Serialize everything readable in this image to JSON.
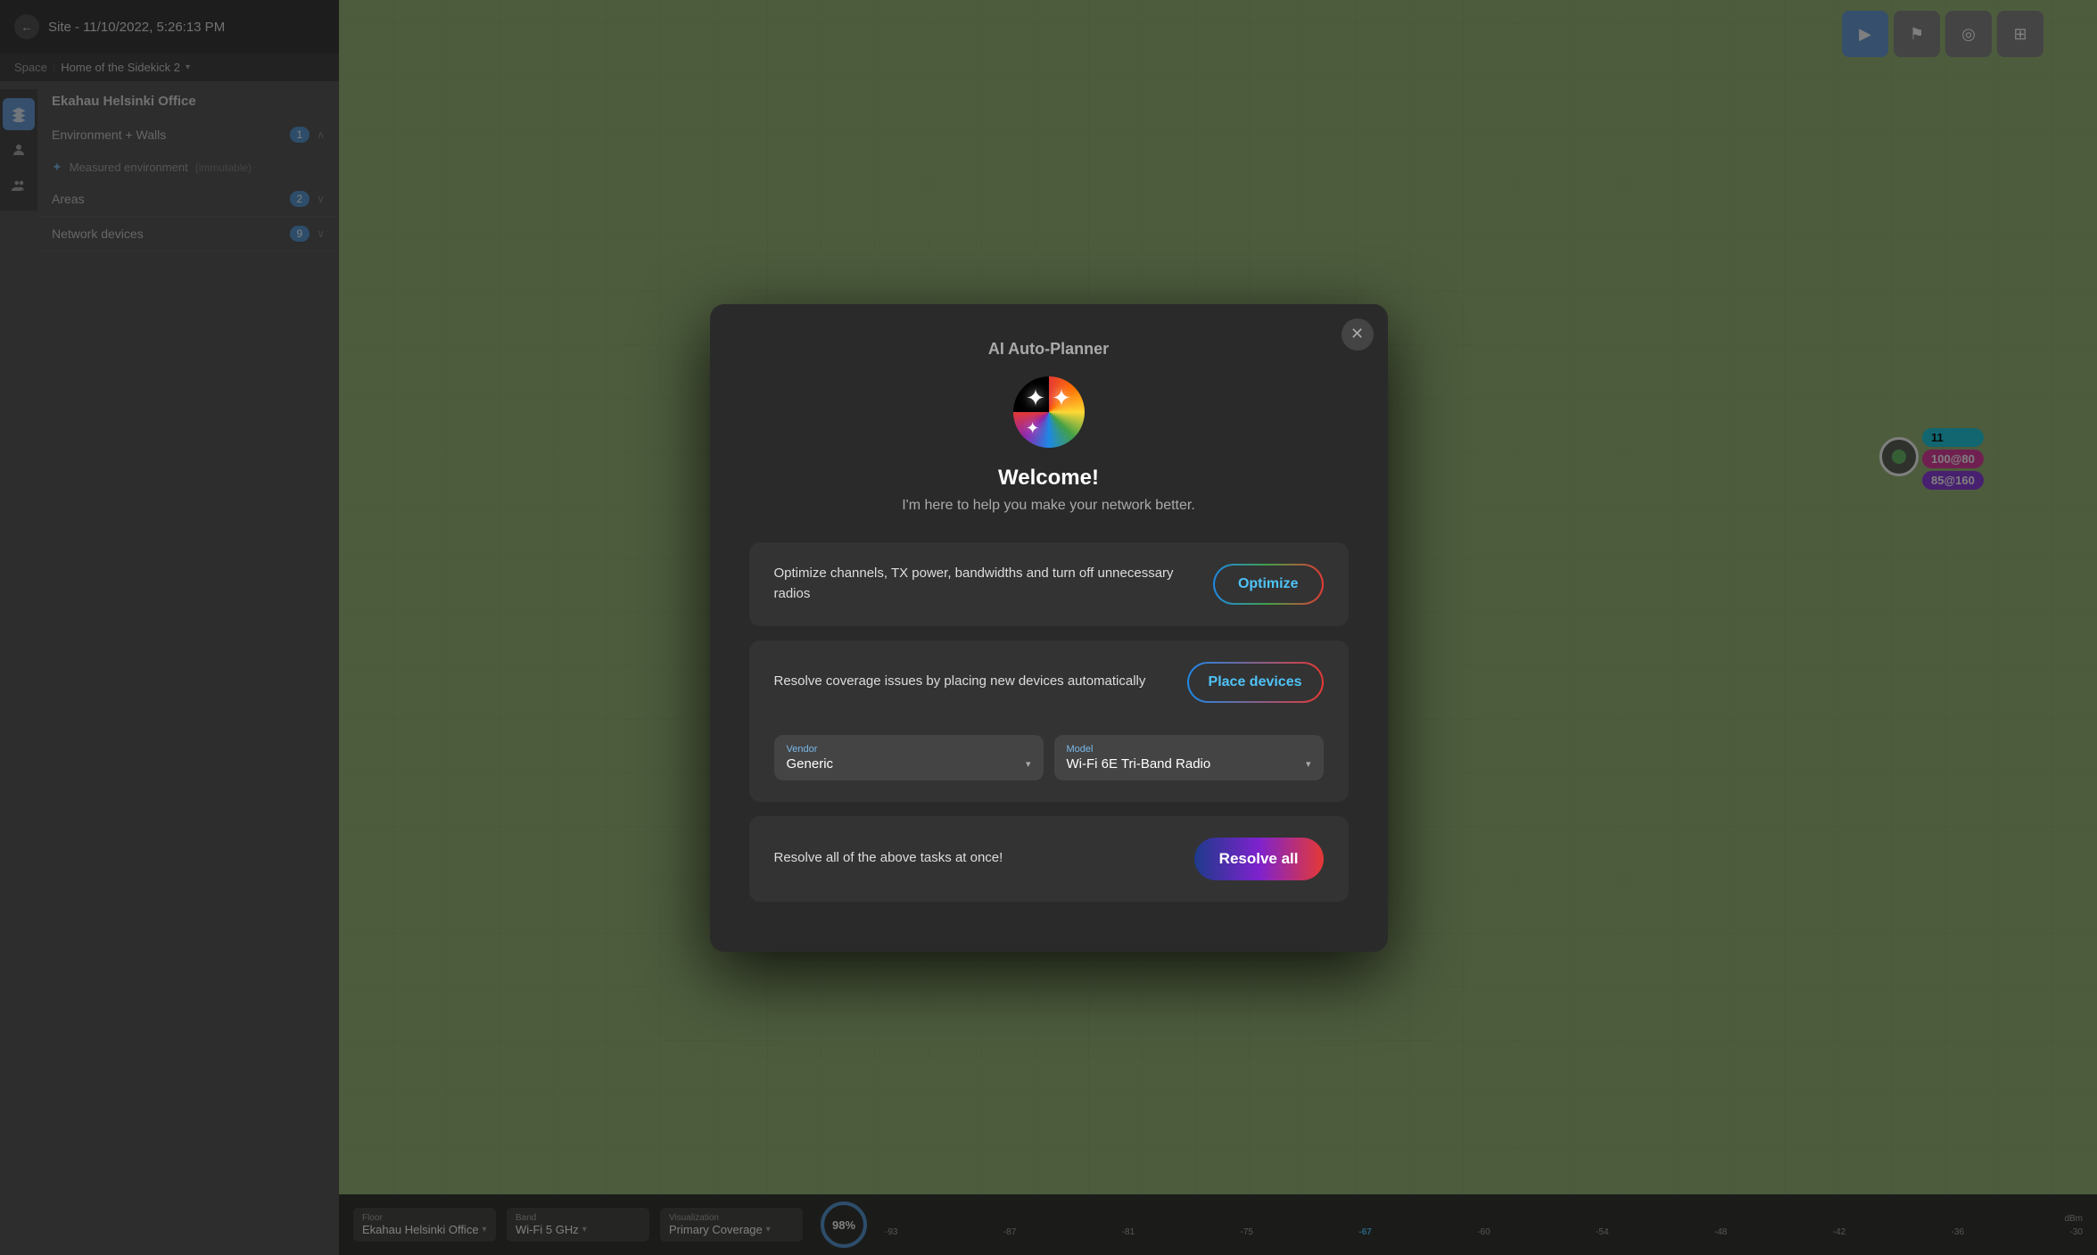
{
  "header": {
    "back_label": "←",
    "site_title": "Site - 11/10/2022, 5:26:13 PM",
    "space_label": "Space",
    "space_name": "Home of the Sidekick 2",
    "dropdown_icon": "▾"
  },
  "sidebar": {
    "building_label": "Ekahau Helsinki Office",
    "sections": [
      {
        "label": "Environment + Walls",
        "badge": "1",
        "chevron": "∧"
      },
      {
        "label": "Areas",
        "badge": "2",
        "chevron": "∨"
      },
      {
        "label": "Network devices",
        "badge": "9",
        "chevron": "∨"
      }
    ],
    "measured_env": {
      "label": "Measured environment",
      "tag": "(immutable)"
    }
  },
  "toolbar": {
    "buttons": [
      {
        "icon": "▶",
        "active": true
      },
      {
        "icon": "⚑",
        "active": false
      },
      {
        "icon": "◎",
        "active": false
      },
      {
        "icon": "⊞",
        "active": false
      }
    ]
  },
  "map": {
    "signal_marker": {
      "label_11": "11",
      "label_100": "100@80",
      "label_85": "85@160"
    }
  },
  "modal": {
    "title": "AI Auto-Planner",
    "close_icon": "✕",
    "icon_stars": "✦✦✦",
    "welcome_title": "Welcome!",
    "welcome_subtitle": "I'm here to help you make your network better.",
    "card1": {
      "text": "Optimize channels, TX power, bandwidths and turn off unnecessary radios",
      "button_label": "Optimize"
    },
    "card2": {
      "text": "Resolve coverage issues by placing new devices automatically",
      "button_label": "Place devices",
      "vendor_label": "Vendor",
      "vendor_value": "Generic",
      "vendor_dropdown": "▾",
      "model_label": "Model",
      "model_value": "Wi-Fi 6E Tri-Band Radio",
      "model_dropdown": "▾"
    },
    "card3": {
      "text": "Resolve all of the above tasks at once!",
      "button_label": "Resolve all"
    }
  },
  "bottom_bar": {
    "floor_label": "Floor",
    "floor_value": "Ekahau Helsinki Office",
    "floor_arrow": "▾",
    "band_label": "Band",
    "band_value": "Wi-Fi 5 GHz",
    "band_arrow": "▾",
    "visualization_label": "Visualization",
    "visualization_value": "Primary Coverage",
    "visualization_arrow": "▾",
    "progress": "98%",
    "dbm_label": "dBm",
    "signal_ticks": [
      "-93",
      "-87",
      "-81",
      "-75",
      "-67",
      "-60",
      "-54",
      "-48",
      "-42",
      "-36",
      "-30"
    ]
  }
}
